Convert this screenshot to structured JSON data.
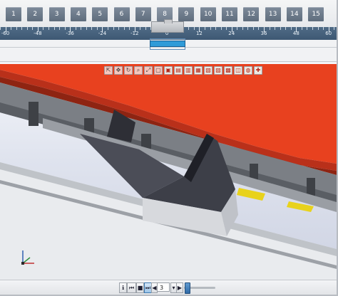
{
  "stations": [
    "1",
    "2",
    "3",
    "4",
    "5",
    "6",
    "7",
    "8",
    "9",
    "10",
    "11",
    "12",
    "13",
    "14",
    "15"
  ],
  "active_station": "8",
  "ruler": {
    "labels": [
      "-60",
      "-48",
      "-36",
      "-24",
      "-12",
      "0",
      "12",
      "24",
      "36",
      "48",
      "60"
    ]
  },
  "view_toolbar": {
    "icons": [
      "cursor-icon",
      "pan-icon",
      "orbit-icon",
      "zoom-icon",
      "zoom-fit-icon",
      "zoom-window-icon",
      "view-iso-icon",
      "view-front-icon",
      "view-back-icon",
      "view-left-icon",
      "view-right-icon",
      "view-top-icon",
      "view-bottom-icon",
      "view-cube-icon",
      "render-icon",
      "add-icon"
    ]
  },
  "player": {
    "step_value": "3"
  },
  "colors": {
    "press_beam": "#e8411f",
    "tooling": "#6d7176",
    "sheet_metal": "#4a4c55",
    "gauge_yellow": "#e8d21c",
    "selection": "#2f9bd8"
  }
}
